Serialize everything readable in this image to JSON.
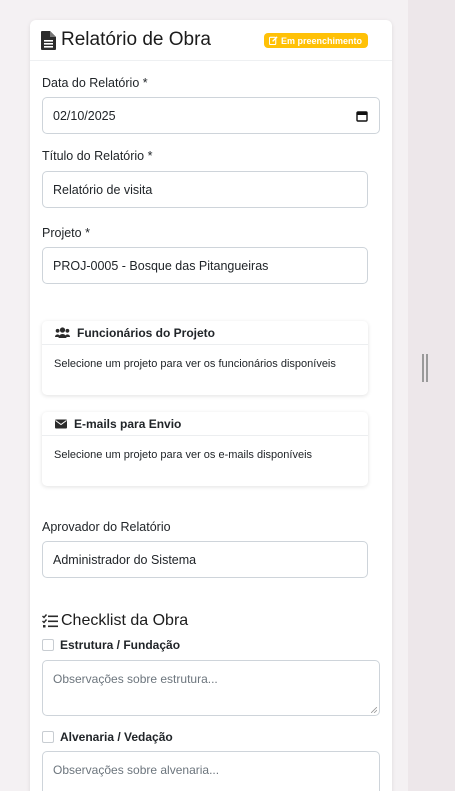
{
  "header": {
    "title": "Relatório de Obra",
    "status_badge": "Em preenchimento"
  },
  "form": {
    "report_date": {
      "label": "Data do Relatório *",
      "value": "02/10/2025"
    },
    "report_title": {
      "label": "Título do Relatório *",
      "value": "Relatório de visita"
    },
    "project": {
      "label": "Projeto *",
      "value": "PROJ-0005 - Bosque das Pitangueiras"
    },
    "approver": {
      "label": "Aprovador do Relatório",
      "value": "Administrador do Sistema"
    }
  },
  "employees_panel": {
    "title": "Funcionários do Projeto",
    "message": "Selecione um projeto para ver os funcionários disponíveis"
  },
  "emails_panel": {
    "title": "E-mails para Envio",
    "message": "Selecione um projeto para ver os e-mails disponíveis"
  },
  "checklist": {
    "title": "Checklist da Obra",
    "items": [
      {
        "label": "Estrutura / Fundação",
        "checked": false,
        "placeholder": "Observações sobre estrutura..."
      },
      {
        "label": "Alvenaria / Vedação",
        "checked": false,
        "placeholder": "Observações sobre alvenaria..."
      }
    ]
  },
  "colors": {
    "badge": "#ffc107",
    "border": "#ced4da",
    "text": "#212529"
  }
}
